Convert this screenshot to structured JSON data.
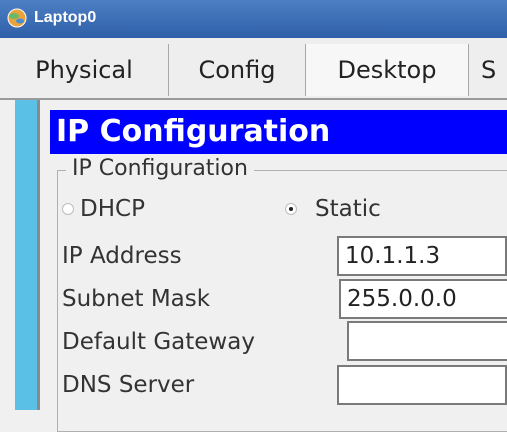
{
  "window": {
    "title": "Laptop0",
    "icon": "laptop-app-icon"
  },
  "tabs": [
    {
      "label": "Physical"
    },
    {
      "label": "Config"
    },
    {
      "label": "Desktop",
      "selected": true
    },
    {
      "label": "S"
    }
  ],
  "panel": {
    "heading": "IP Configuration",
    "group_title": "IP Configuration",
    "mode": {
      "dhcp_label": "DHCP",
      "static_label": "Static",
      "selected": "Static"
    },
    "fields": {
      "ip_address": {
        "label": "IP Address",
        "value": "10.1.1.3"
      },
      "subnet_mask": {
        "label": "Subnet Mask",
        "value": "255.0.0.0"
      },
      "default_gateway": {
        "label": "Default Gateway",
        "value": ""
      },
      "dns_server": {
        "label": "DNS Server",
        "value": ""
      }
    }
  },
  "colors": {
    "titlebar": "#3a6db8",
    "heading_bar": "#0000ff",
    "side_stripe": "#5bc0e6"
  }
}
